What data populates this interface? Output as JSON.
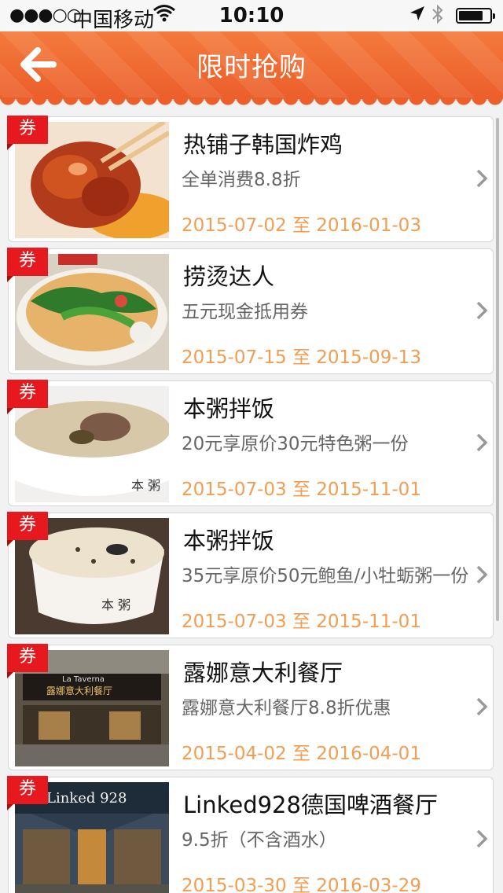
{
  "status_bar": {
    "signal": "●●●○○",
    "carrier": "中国移动",
    "time": "10:10"
  },
  "nav": {
    "title": "限时抢购"
  },
  "deals": [
    {
      "tag": "券",
      "title": "热铺子韩国炸鸡",
      "desc": "全单消费8.8折",
      "date": "2015-07-02 至 2016-01-03",
      "image": "fried-chicken-photo"
    },
    {
      "tag": "券",
      "title": "捞烫达人",
      "desc": "五元现金抵用券",
      "date": "2015-07-15 至 2015-09-13",
      "image": "noodle-soup-photo"
    },
    {
      "tag": "券",
      "title": "本粥拌饭",
      "desc": "20元享原价30元特色粥一份",
      "date": "2015-07-03 至 2015-11-01",
      "image": "porridge-photo"
    },
    {
      "tag": "券",
      "title": "本粥拌饭",
      "desc": "35元享原价50元鲍鱼/小牡蛎粥一份",
      "date": "2015-07-03 至 2015-11-01",
      "image": "porridge-photo"
    },
    {
      "tag": "券",
      "title": "露娜意大利餐厅",
      "desc": "露娜意大利餐厅8.8折优惠",
      "date": "2015-04-02 至 2016-04-01",
      "image": "restaurant-front-photo",
      "sign_en": "La Taverna",
      "sign_cn": "露娜意大利餐厅"
    },
    {
      "tag": "券",
      "title": "Linked928德国啤酒餐厅",
      "desc": "9.5折（不含酒水）",
      "date": "2015-03-30 至 2016-03-29",
      "image": "beer-restaurant-photo",
      "sign": "Linked 928"
    }
  ],
  "colors": {
    "accent": "#f06a32",
    "tag": "#e8191e",
    "date": "#f19d52"
  }
}
